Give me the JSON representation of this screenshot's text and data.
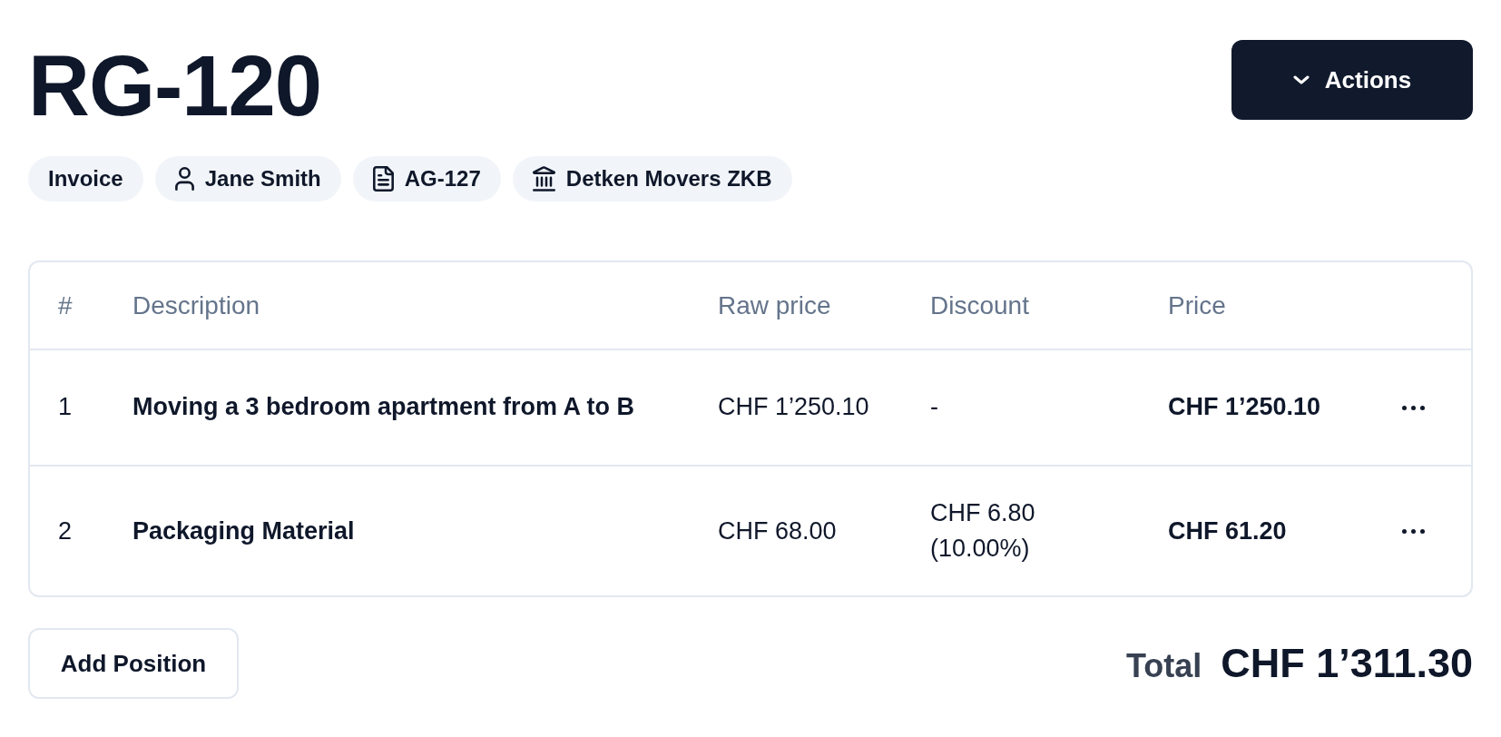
{
  "header": {
    "title": "RG-120",
    "actions_button": {
      "label": "Actions"
    }
  },
  "tags": [
    {
      "kind": "plain",
      "label": "Invoice"
    },
    {
      "kind": "person",
      "label": "Jane Smith"
    },
    {
      "kind": "document",
      "label": "AG-127"
    },
    {
      "kind": "bank",
      "label": "Detken Movers ZKB"
    }
  ],
  "table": {
    "columns": [
      "#",
      "Description",
      "Raw price",
      "Discount",
      "Price"
    ],
    "rows": [
      {
        "number": "1",
        "description": "Moving a 3 bedroom apartment from A to B",
        "raw_price": "CHF 1’250.10",
        "discount": "-",
        "price": "CHF 1’250.10"
      },
      {
        "number": "2",
        "description": "Packaging Material",
        "raw_price": "CHF 68.00",
        "discount": "CHF 6.80 (10.00%)",
        "price": "CHF 61.20"
      }
    ]
  },
  "footer": {
    "add_button": "Add Position",
    "total_label": "Total",
    "total_value": "CHF 1’311.30"
  }
}
